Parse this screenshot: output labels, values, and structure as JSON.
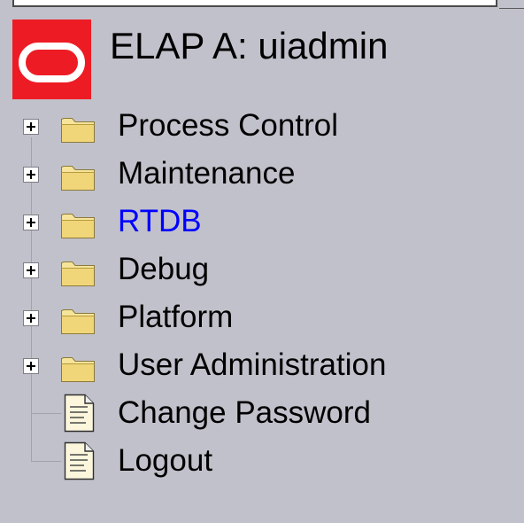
{
  "header": {
    "title": "ELAP A: uiadmin",
    "logo": "oracle-logo"
  },
  "menu": {
    "items": [
      {
        "label": "Process Control",
        "type": "folder",
        "icon": "folder-icon"
      },
      {
        "label": "Maintenance",
        "type": "folder",
        "icon": "folder-icon"
      },
      {
        "label": "RTDB",
        "type": "folder",
        "icon": "folder-icon",
        "color": "#0000ff"
      },
      {
        "label": "Debug",
        "type": "folder",
        "icon": "folder-icon"
      },
      {
        "label": "Platform",
        "type": "folder",
        "icon": "folder-icon"
      },
      {
        "label": "User Administration",
        "type": "folder",
        "icon": "folder-icon"
      },
      {
        "label": "Change Password",
        "type": "page",
        "icon": "document-icon"
      },
      {
        "label": "Logout",
        "type": "page",
        "icon": "document-icon"
      }
    ]
  },
  "colors": {
    "background": "#c1c1cb",
    "logo_red": "#ed1c24",
    "active_link": "#0000ff",
    "folder_fill": "#f5e49a"
  }
}
